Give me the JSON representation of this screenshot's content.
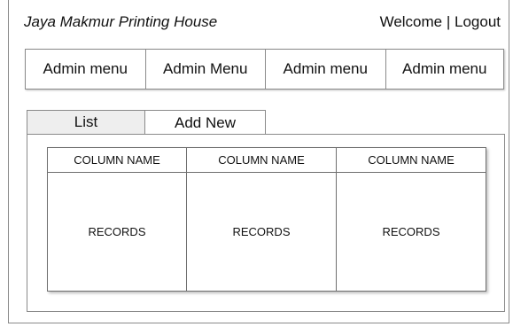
{
  "header": {
    "brand": "Jaya Makmur Printing House",
    "welcome": "Welcome",
    "separator": "|",
    "logout": "Logout"
  },
  "menu": {
    "items": [
      {
        "label": "Admin menu"
      },
      {
        "label": "Admin Menu"
      },
      {
        "label": "Admin menu"
      },
      {
        "label": "Admin menu"
      }
    ]
  },
  "tabs": [
    {
      "label": "List"
    },
    {
      "label": "Add New"
    }
  ],
  "table": {
    "columns": [
      {
        "header": "COLUMN NAME",
        "body": "RECORDS"
      },
      {
        "header": "COLUMN NAME",
        "body": "RECORDS"
      },
      {
        "header": "COLUMN NAME",
        "body": "RECORDS"
      }
    ]
  }
}
